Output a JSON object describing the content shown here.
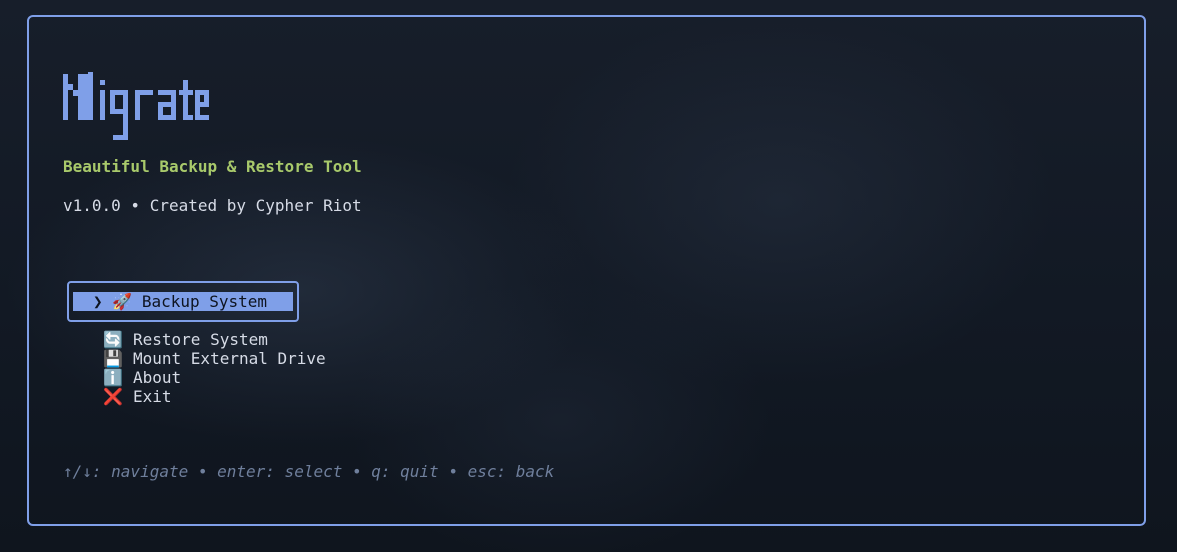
{
  "app": {
    "logo_text": "Migrate",
    "subtitle": "Beautiful Backup & Restore Tool",
    "version_line": "v1.0.0 • Created by Cypher Riot"
  },
  "menu": {
    "selected": {
      "label": "❯ 🚀 Backup System"
    },
    "items": [
      {
        "emoji": "🔄",
        "label": "Restore System"
      },
      {
        "emoji": "💾",
        "label": "Mount External Drive"
      },
      {
        "emoji": "ℹ️",
        "label": "About"
      },
      {
        "emoji": "❌",
        "label": "Exit"
      }
    ]
  },
  "help": {
    "text": "↑/↓: navigate • enter: select • q: quit • esc: back"
  },
  "colors": {
    "accent": "#7f9fe8",
    "subtitle": "#a8c96b",
    "text": "#d6dbe6",
    "muted": "#6f7f9c"
  }
}
